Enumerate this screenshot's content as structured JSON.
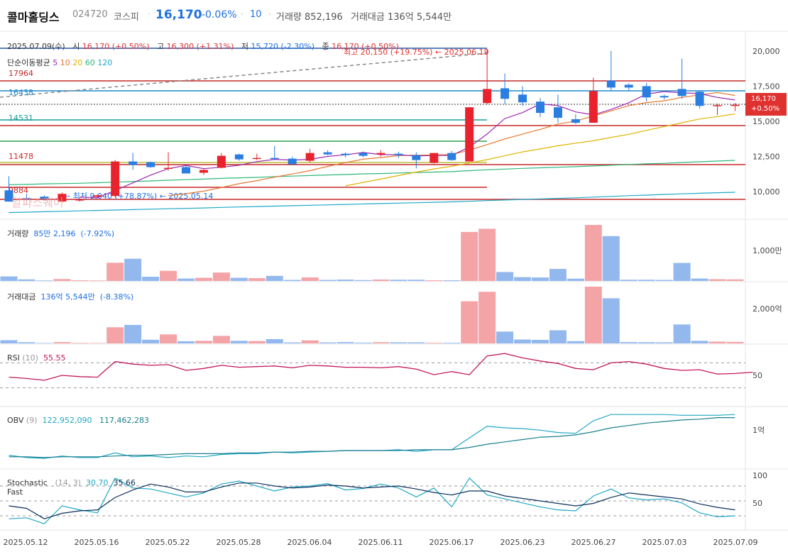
{
  "header": {
    "name": "콜마홀딩스",
    "code": "024720",
    "market": "코스피",
    "price": "16,170",
    "change": "-0.06%",
    "ten": "10",
    "dot": "·",
    "volume_text": "거래량 852,196",
    "value_text": "거래대금 136억 5,544만"
  },
  "ohlc": {
    "date": "2025.07.09(수)",
    "open_label": "시",
    "open": "16,170 (+0.50%)",
    "high_label": "고",
    "high": "16,300 (+1.31%)",
    "low_label": "저",
    "low": "15,720 (-2.30%)",
    "close_label": "종",
    "close": "16,170 (+0.50%)"
  },
  "ma": {
    "label": "단순이동평균",
    "p5": "5",
    "p10": "10",
    "p20": "20",
    "p60": "60",
    "p120": "120"
  },
  "annotations": {
    "high": "최고 20,150 (+19.75%) ← 2025.06.19",
    "low": "← 최저 9,040 (+78.87%) ← 2025.05.14",
    "h17964": "17964",
    "h16438": "16438",
    "h14531": "14531",
    "h11478": "11478",
    "h9884": "9884"
  },
  "badge": {
    "price": "16,170",
    "pct": "+0.50%"
  },
  "watermark": "알파스퀘어",
  "panels": {
    "volume": {
      "label": "거래량",
      "value": "85만 2,196",
      "pct": "(-7.92%)",
      "axis": "1,000만"
    },
    "amount": {
      "label": "거래대금",
      "value": "136억 5,544만",
      "pct": "(-8.38%)",
      "axis": "2,000억"
    },
    "rsi": {
      "label": "RSI",
      "param": "(10)",
      "value": "55.55",
      "axis": "50"
    },
    "obv": {
      "label": "OBV",
      "param": "(9)",
      "v1": "122,952,090",
      "v2": "117,462,283",
      "axis": "1억"
    },
    "stoch": {
      "label": "Stochastic",
      "label2": "Fast",
      "param": "(14, 3)",
      "v1": "30.70",
      "v2": "35.66",
      "axis100": "100",
      "axis50": "50"
    }
  },
  "price_axis": [
    "20,000",
    "17,500",
    "15,000",
    "12,500",
    "10,000"
  ],
  "x_dates": [
    "2025.05.12",
    "2025.05.16",
    "2025.05.22",
    "2025.05.28",
    "2025.06.04",
    "2025.06.11",
    "2025.06.17",
    "2025.06.23",
    "2025.06.27",
    "2025.07.03",
    "2025.07.09"
  ],
  "colors": {
    "up": "#e8232d",
    "down": "#2a7de1",
    "ma5": "#9c27b0",
    "ma10": "#e8772e",
    "ma20": "#e0b400",
    "ma60": "#2eb87a",
    "ma120": "#1fa8c9"
  },
  "chart_data": {
    "type": "candlestick",
    "ylim": [
      8500,
      21200
    ],
    "candles": [
      {
        "o": 10100,
        "h": 11100,
        "l": 9300,
        "c": 9300
      },
      {
        "o": 9550,
        "h": 9850,
        "l": 9400,
        "c": 9500
      },
      {
        "o": 9650,
        "h": 9750,
        "l": 9400,
        "c": 9500
      },
      {
        "o": 9300,
        "h": 9950,
        "l": 9250,
        "c": 9850
      },
      {
        "o": 9450,
        "h": 9550,
        "l": 9300,
        "c": 9450
      },
      {
        "o": 9650,
        "h": 9800,
        "l": 9550,
        "c": 9750
      },
      {
        "o": 9700,
        "h": 12250,
        "l": 9600,
        "c": 12150
      },
      {
        "o": 12150,
        "h": 12750,
        "l": 11550,
        "c": 11900
      },
      {
        "o": 12100,
        "h": 12150,
        "l": 11700,
        "c": 11750
      },
      {
        "o": 11650,
        "h": 12800,
        "l": 11500,
        "c": 11700
      },
      {
        "o": 11750,
        "h": 11900,
        "l": 11350,
        "c": 11300
      },
      {
        "o": 11350,
        "h": 11600,
        "l": 11200,
        "c": 11550
      },
      {
        "o": 11700,
        "h": 12750,
        "l": 11650,
        "c": 12550
      },
      {
        "o": 12650,
        "h": 12700,
        "l": 12200,
        "c": 12300
      },
      {
        "o": 12350,
        "h": 12700,
        "l": 12250,
        "c": 12400
      },
      {
        "o": 12400,
        "h": 13250,
        "l": 12250,
        "c": 12350
      },
      {
        "o": 12350,
        "h": 12500,
        "l": 11950,
        "c": 11950
      },
      {
        "o": 12200,
        "h": 13050,
        "l": 12100,
        "c": 12750
      },
      {
        "o": 12800,
        "h": 12950,
        "l": 12600,
        "c": 12650
      },
      {
        "o": 12700,
        "h": 12800,
        "l": 12450,
        "c": 12600
      },
      {
        "o": 12750,
        "h": 12850,
        "l": 12450,
        "c": 12550
      },
      {
        "o": 12650,
        "h": 12950,
        "l": 12500,
        "c": 12750
      },
      {
        "o": 12700,
        "h": 12850,
        "l": 12400,
        "c": 12600
      },
      {
        "o": 12600,
        "h": 12800,
        "l": 11650,
        "c": 12250
      },
      {
        "o": 12050,
        "h": 12750,
        "l": 12000,
        "c": 12750
      },
      {
        "o": 12750,
        "h": 12900,
        "l": 12200,
        "c": 12250
      },
      {
        "o": 12150,
        "h": 16000,
        "l": 12150,
        "c": 16000
      },
      {
        "o": 16300,
        "h": 20150,
        "l": 16200,
        "c": 17300
      },
      {
        "o": 17350,
        "h": 18400,
        "l": 16200,
        "c": 16600
      },
      {
        "o": 16900,
        "h": 17500,
        "l": 16100,
        "c": 16350
      },
      {
        "o": 16400,
        "h": 16650,
        "l": 15300,
        "c": 15600
      },
      {
        "o": 16000,
        "h": 16900,
        "l": 14900,
        "c": 15250
      },
      {
        "o": 15150,
        "h": 15500,
        "l": 14800,
        "c": 14900
      },
      {
        "o": 14900,
        "h": 18100,
        "l": 14900,
        "c": 17150
      },
      {
        "o": 17900,
        "h": 20000,
        "l": 17200,
        "c": 17400
      },
      {
        "o": 17600,
        "h": 17700,
        "l": 17200,
        "c": 17400
      },
      {
        "o": 17500,
        "h": 17750,
        "l": 16400,
        "c": 16700
      },
      {
        "o": 16800,
        "h": 16900,
        "l": 16550,
        "c": 16700
      },
      {
        "o": 17300,
        "h": 19450,
        "l": 16600,
        "c": 16800
      },
      {
        "o": 17100,
        "h": 17200,
        "l": 15900,
        "c": 16100
      },
      {
        "o": 16100,
        "h": 16250,
        "l": 15450,
        "c": 16150
      },
      {
        "o": 16170,
        "h": 16300,
        "l": 15720,
        "c": 16170
      }
    ],
    "volume": [
      1.3,
      0.45,
      0.15,
      0.55,
      0.2,
      0.15,
      5.2,
      6.35,
      1.2,
      2.9,
      0.7,
      0.9,
      2.4,
      0.9,
      0.8,
      1.45,
      0.3,
      1.0,
      0.3,
      0.4,
      0.25,
      0.4,
      0.35,
      0.35,
      0.2,
      0.2,
      14.0,
      14.9,
      2.55,
      1.1,
      1.0,
      3.45,
      0.65,
      16.0,
      12.8,
      0.35,
      0.35,
      0.3,
      5.15,
      0.7,
      0.5,
      0.45
    ],
    "amount": [
      150,
      55,
      20,
      60,
      25,
      20,
      750,
      860,
      170,
      420,
      100,
      120,
      350,
      120,
      110,
      200,
      45,
      140,
      45,
      60,
      35,
      55,
      50,
      50,
      30,
      30,
      1960,
      2400,
      550,
      180,
      165,
      610,
      105,
      2640,
      2100,
      60,
      55,
      50,
      880,
      120,
      80,
      70
    ],
    "rsi": [
      47,
      45,
      42,
      50,
      48,
      47,
      72,
      68,
      66,
      67,
      58,
      61,
      66,
      63,
      64,
      65,
      62,
      66,
      65,
      63,
      63,
      62,
      64,
      60,
      51,
      56,
      51,
      81,
      85,
      78,
      73,
      69,
      61,
      59,
      70,
      72,
      68,
      61,
      58,
      59,
      52,
      53,
      55
    ],
    "obv1": [
      -2.2,
      -2.5,
      -2.6,
      -2.3,
      -2.5,
      -2.5,
      -1.9,
      -2.4,
      -2.3,
      -2.5,
      -2.3,
      -2.4,
      -2.1,
      -2.0,
      -2.0,
      -1.8,
      -1.9,
      -1.8,
      -1.7,
      -1.6,
      -1.6,
      -1.6,
      -1.5,
      -1.7,
      -1.5,
      -1.5,
      0.0,
      1.5,
      1.3,
      1.2,
      1.0,
      0.7,
      0.6,
      2.2,
      3.0,
      3.0,
      3.0,
      3.0,
      2.9,
      2.9,
      2.9,
      3.0
    ],
    "obv2": [
      -2.4,
      -2.4,
      -2.5,
      -2.4,
      -2.4,
      -2.4,
      -2.3,
      -2.2,
      -2.2,
      -2.1,
      -2.0,
      -2.0,
      -2.0,
      -1.9,
      -1.9,
      -1.8,
      -1.8,
      -1.7,
      -1.7,
      -1.6,
      -1.6,
      -1.6,
      -1.6,
      -1.5,
      -1.5,
      -1.5,
      -1.2,
      -0.8,
      -0.5,
      -0.2,
      0.1,
      0.2,
      0.4,
      0.8,
      1.3,
      1.6,
      1.9,
      2.1,
      2.3,
      2.4,
      2.6,
      2.6
    ],
    "stoch1": [
      14,
      16,
      4,
      40,
      32,
      26,
      96,
      76,
      74,
      66,
      58,
      66,
      84,
      90,
      80,
      70,
      78,
      80,
      85,
      72,
      75,
      84,
      76,
      58,
      76,
      38,
      96,
      62,
      54,
      46,
      38,
      32,
      30,
      60,
      74,
      56,
      52,
      54,
      46,
      26,
      18,
      20
    ],
    "stoch2": [
      40,
      35,
      14,
      25,
      30,
      32,
      57,
      72,
      84,
      78,
      68,
      68,
      78,
      86,
      86,
      80,
      76,
      78,
      82,
      80,
      76,
      78,
      80,
      74,
      67,
      62,
      70,
      70,
      60,
      55,
      50,
      45,
      40,
      45,
      57,
      66,
      62,
      58,
      54,
      44,
      37,
      32
    ],
    "ma5": [
      null,
      null,
      null,
      null,
      9620,
      9580,
      10090,
      10630,
      11180,
      11640,
      11870,
      11640,
      11740,
      11880,
      12140,
      12300,
      12250,
      12300,
      12510,
      12620,
      12790,
      12640,
      12630,
      12540,
      12570,
      12580,
      13170,
      14100,
      15200,
      15620,
      16240,
      16120,
      15670,
      15460,
      15850,
      16320,
      16940,
      17110,
      17020,
      16970,
      16700,
      16520
    ],
    "ma10": [
      null,
      null,
      null,
      null,
      null,
      null,
      null,
      null,
      null,
      9720,
      9860,
      10040,
      10300,
      10570,
      10790,
      11040,
      11260,
      11500,
      11800,
      12070,
      12310,
      12430,
      12560,
      12600,
      12600,
      12650,
      12950,
      13350,
      13750,
      14090,
      14430,
      14810,
      15010,
      15390,
      15740,
      16120,
      16330,
      16460,
      16700,
      16880,
      17040,
      16840
    ],
    "ma20": [
      null,
      null,
      null,
      null,
      null,
      null,
      null,
      null,
      null,
      null,
      null,
      null,
      null,
      null,
      null,
      null,
      null,
      null,
      null,
      10420,
      10660,
      10900,
      11150,
      11400,
      11620,
      11810,
      12040,
      12280,
      12560,
      12830,
      13040,
      13270,
      13450,
      13620,
      13860,
      14080,
      14360,
      14630,
      14900,
      15170,
      15340,
      15520
    ],
    "ma60": [
      10500,
      10520,
      10560,
      10580,
      10600,
      10640,
      10680,
      10720,
      10770,
      10820,
      10860,
      10900,
      10950,
      10990,
      11020,
      11070,
      11110,
      11150,
      11190,
      11220,
      11270,
      11290,
      11330,
      11370,
      11400,
      11430,
      11500,
      11560,
      11610,
      11660,
      11700,
      11740,
      11780,
      11830,
      11880,
      11930,
      11980,
      12020,
      12080,
      12130,
      12180,
      12230
    ],
    "ma120": [
      8520,
      8550,
      8580,
      8610,
      8640,
      8670,
      8700,
      8730,
      8760,
      8790,
      8820,
      8850,
      8890,
      8920,
      8950,
      8980,
      9010,
      9040,
      9070,
      9100,
      9130,
      9160,
      9190,
      9220,
      9250,
      9280,
      9320,
      9370,
      9410,
      9450,
      9490,
      9530,
      9570,
      9620,
      9670,
      9720,
      9760,
      9810,
      9850,
      9890,
      9930,
      9960
    ]
  }
}
